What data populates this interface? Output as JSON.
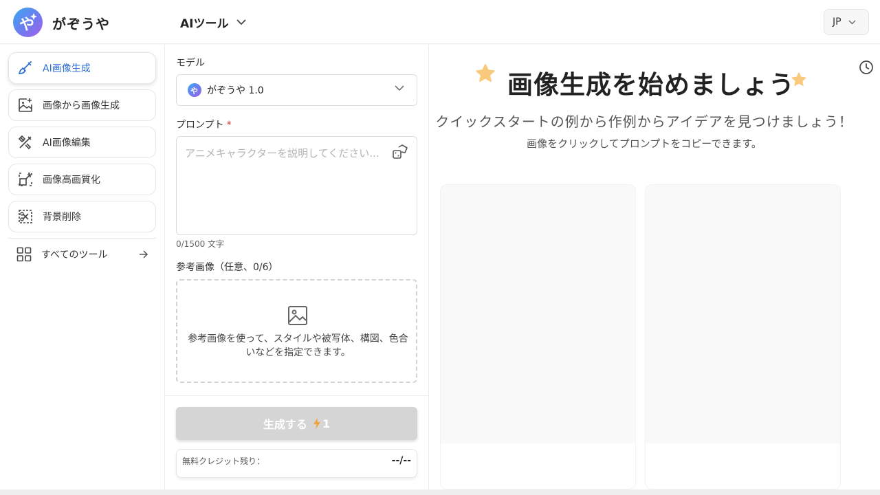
{
  "header": {
    "brand": "がぞうや",
    "tools_menu": "AIツール",
    "language": "JP"
  },
  "sidebar": {
    "items": [
      {
        "label": "AI画像生成",
        "icon": "brush-icon",
        "active": true
      },
      {
        "label": "画像から画像生成",
        "icon": "image-plus-icon",
        "active": false
      },
      {
        "label": "AI画像編集",
        "icon": "edit-tools-icon",
        "active": false
      },
      {
        "label": "画像高画質化",
        "icon": "upscale-icon",
        "active": false
      },
      {
        "label": "背景削除",
        "icon": "background-remove-icon",
        "active": false
      }
    ],
    "all_tools": "すべてのツール"
  },
  "form": {
    "model_label": "モデル",
    "model_value": "がぞうや 1.0",
    "prompt_label": "プロンプト",
    "prompt_required": "*",
    "prompt_placeholder": "アニメキャラクターを説明してください...",
    "char_count": "0/1500 文字",
    "ref_label": "参考画像（任意、0/6）",
    "ref_hint": "参考画像を使って、スタイルや被写体、構図、色合いなどを指定できます。",
    "generate_label": "生成する",
    "generate_cost": "1",
    "credit_label": "無料クレジット残り：",
    "credit_value": "--/--"
  },
  "main": {
    "title": "画像生成を始めましょう",
    "subtitle": "クイックスタートの例から作例からアイデアを見つけましょう！",
    "note": "画像をクリックしてプロンプトをコピーできます。"
  },
  "colors": {
    "accent": "#2f6fd4",
    "star": "#f9c97c",
    "required": "#e03a3a",
    "button_disabled": "#d5d5d5"
  }
}
